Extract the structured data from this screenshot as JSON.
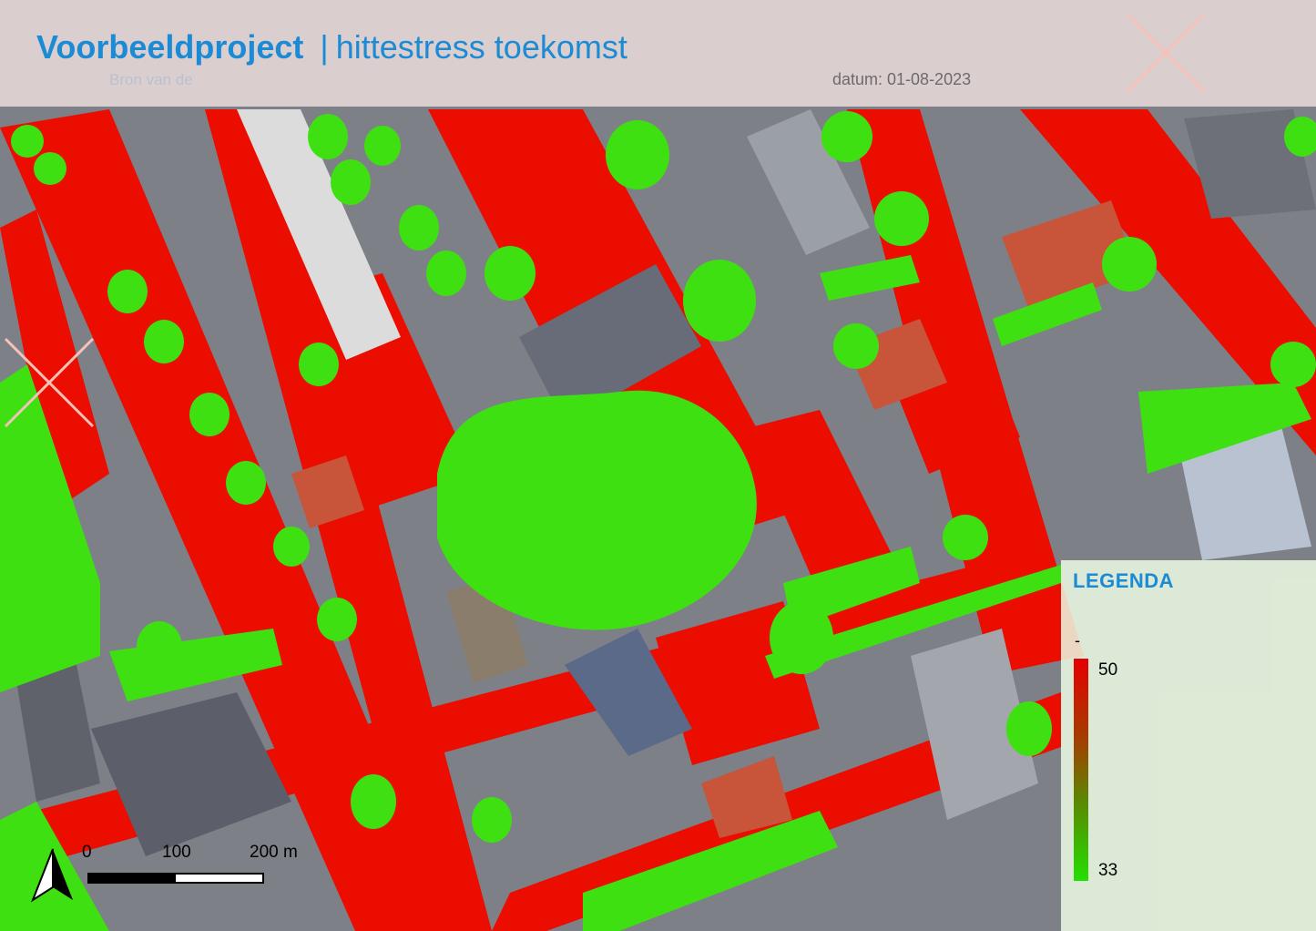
{
  "header": {
    "project": "Voorbeeldproject",
    "separator": "|",
    "topic": "hittestress toekomst",
    "date_label": "datum: 01-08-2023",
    "faded_subtitle": "Bron van de"
  },
  "legend": {
    "title": "LEGENDA",
    "category_label": "-",
    "max_label": "50",
    "min_label": "33",
    "color_hot": "#e60000",
    "color_cool": "#22e000"
  },
  "scalebar": {
    "labels": [
      "0",
      "100",
      "200 m"
    ]
  },
  "north_arrow": {
    "icon": "north-arrow-icon"
  },
  "map": {
    "type": "heat-stress overlay on aerial imagery",
    "colors": {
      "heat": "#ea0d00",
      "cool": "#3fe011",
      "roof_light": "#d9d9d9",
      "roof_dark": "#5b5d66",
      "roof_red": "#c8543a"
    }
  }
}
